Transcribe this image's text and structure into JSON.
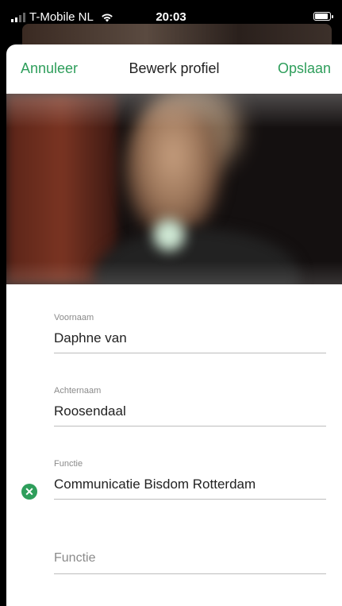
{
  "status_bar": {
    "carrier": "T-Mobile NL",
    "time": "20:03"
  },
  "navbar": {
    "cancel_label": "Annuleer",
    "title": "Bewerk profiel",
    "save_label": "Opslaan"
  },
  "colors": {
    "accent": "#2e9e5b"
  },
  "form": {
    "first_name": {
      "label": "Voornaam",
      "value": "Daphne van"
    },
    "last_name": {
      "label": "Achternaam",
      "value": "Roosendaal"
    },
    "function": {
      "label": "Functie",
      "value": "Communicatie Bisdom Rotterdam",
      "clear_icon": "x-circle-icon"
    },
    "function_2": {
      "placeholder": "Functie"
    }
  }
}
